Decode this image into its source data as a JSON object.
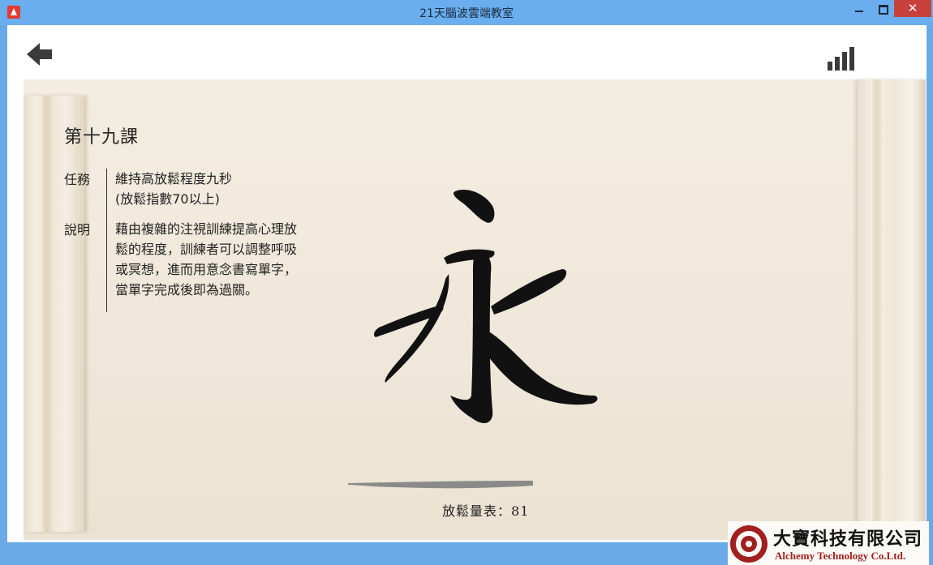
{
  "window": {
    "title": "21天腦波雲端教室",
    "close_glyph": "✕"
  },
  "toolbar": {
    "back_icon": "back-arrow-icon",
    "signal_icon": "signal-strength-icon"
  },
  "lesson": {
    "title": "第十九課",
    "task_label": "任務",
    "task_text": [
      "維持高放鬆程度九秒",
      "(放鬆指數70以上)"
    ],
    "desc_label": "說明",
    "desc_text": [
      "藉由複雜的注視訓練提高心理放",
      "鬆的程度，訓練者可以調整呼吸",
      "或冥想，進而用意念書寫單字，",
      "當單字完成後即為過關。"
    ]
  },
  "practice": {
    "character": "永",
    "meter_label": "放鬆量表：",
    "meter_value": "81"
  },
  "company": {
    "name_zh": "大寶科技有限公司",
    "name_en": "Alchemy Technology Co.Ltd."
  },
  "colors": {
    "titlebar": "#6aaef0",
    "close": "#c8403a",
    "ink": "#111111",
    "scroll": "#f0e9dc",
    "logo_red": "#a11f1f"
  }
}
